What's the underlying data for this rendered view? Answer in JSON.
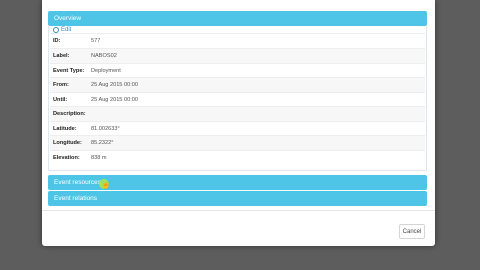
{
  "overview": {
    "title": "Overview",
    "edit_label": "Edit",
    "fields": [
      {
        "label": "ID:",
        "value": "577"
      },
      {
        "label": "Label:",
        "value": "NABOS02"
      },
      {
        "label": "Event Type:",
        "value": "Deployment"
      },
      {
        "label": "From:",
        "value": "25 Aug 2015 00:00"
      },
      {
        "label": "Until:",
        "value": "25 Aug 2015 00:00"
      },
      {
        "label": "Description:",
        "value": ""
      },
      {
        "label": "Latitude:",
        "value": "81.002633°"
      },
      {
        "label": "Longitude:",
        "value": "85.2322°"
      },
      {
        "label": "Elevation:",
        "value": "838 m"
      }
    ]
  },
  "sections": {
    "event_resources": "Event resources",
    "event_relations": "Event relations"
  },
  "footer": {
    "cancel_label": "Cancel"
  },
  "colors": {
    "panel_header": "#4ec5e6",
    "backdrop": "#5d5d5d"
  }
}
